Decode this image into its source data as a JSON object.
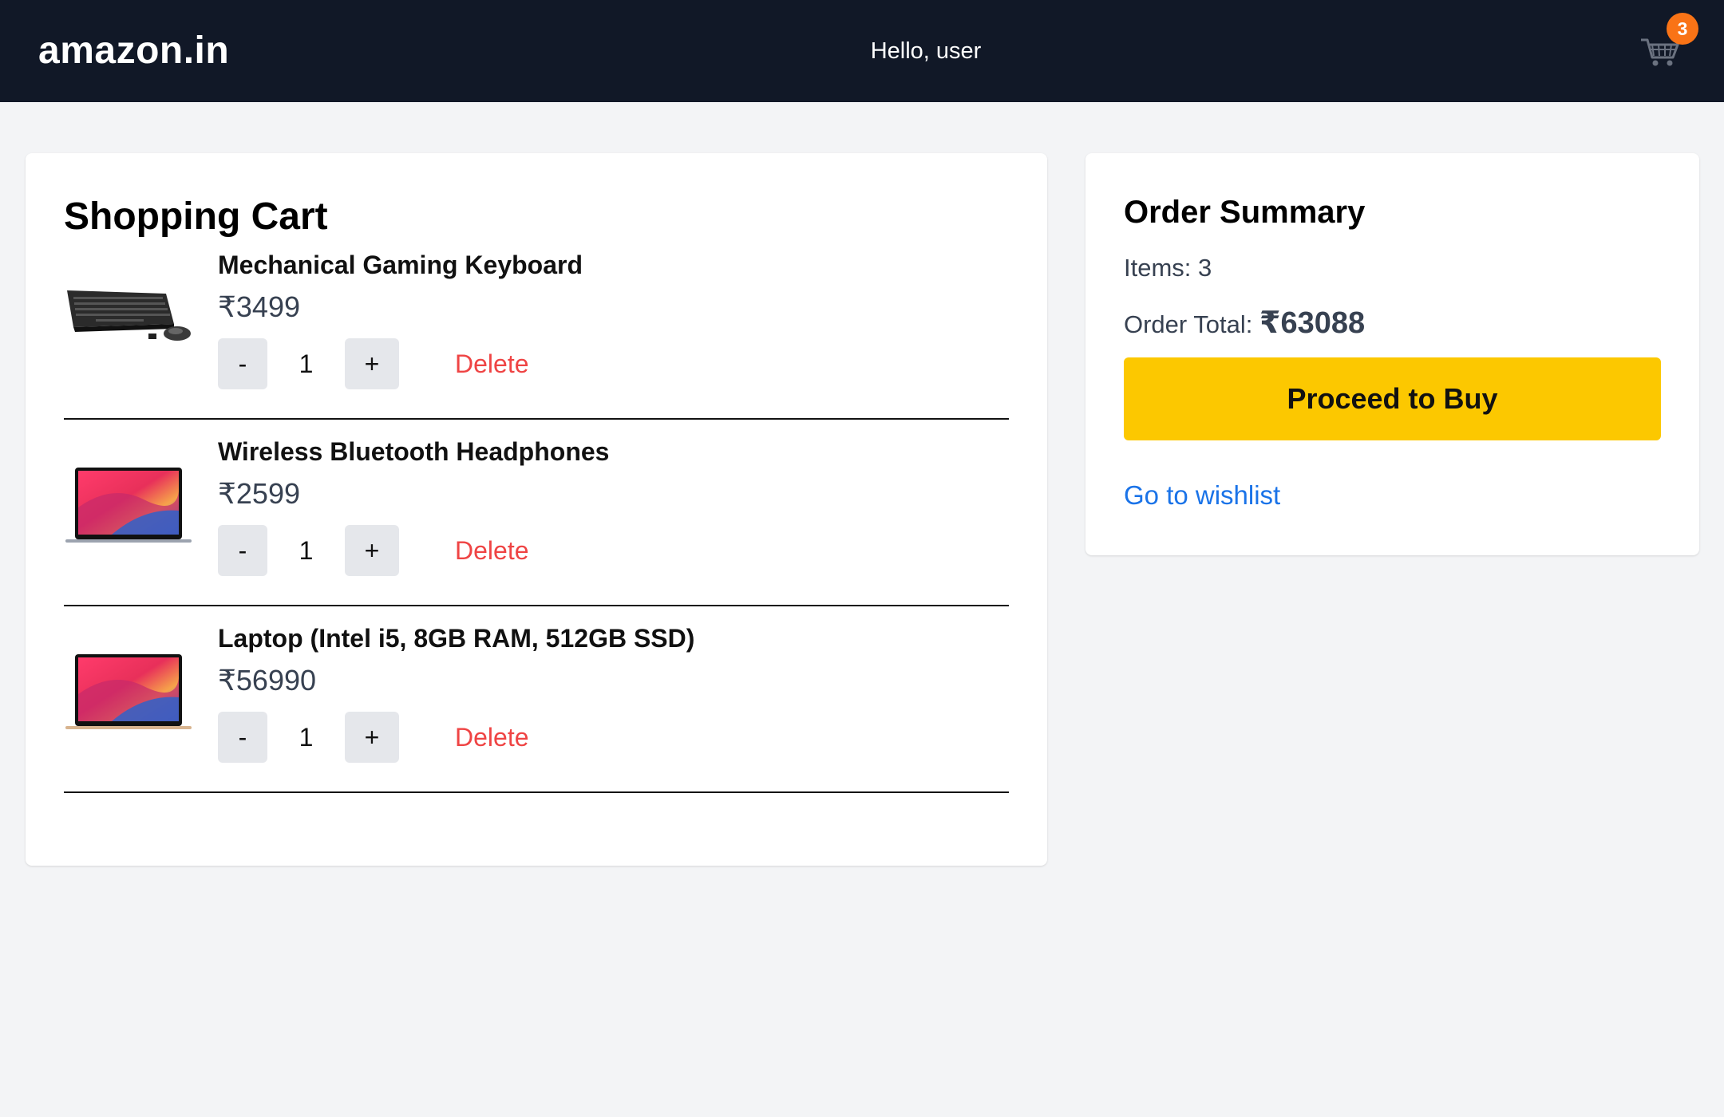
{
  "header": {
    "logo": "amazon.in",
    "greeting": "Hello, user",
    "cart_icon": "shopping-cart-icon",
    "cart_count": "3"
  },
  "cart": {
    "title": "Shopping Cart",
    "items": [
      {
        "image": "keyboard-mouse-image",
        "name": "Mechanical Gaming Keyboard",
        "price": "₹3499",
        "qty": "1",
        "minus": "-",
        "plus": "+",
        "delete": "Delete"
      },
      {
        "image": "laptop-image",
        "name": "Wireless Bluetooth Headphones",
        "price": "₹2599",
        "qty": "1",
        "minus": "-",
        "plus": "+",
        "delete": "Delete"
      },
      {
        "image": "laptop-image",
        "name": "Laptop (Intel i5, 8GB RAM, 512GB SSD)",
        "price": "₹56990",
        "qty": "1",
        "minus": "-",
        "plus": "+",
        "delete": "Delete"
      }
    ]
  },
  "summary": {
    "title": "Order Summary",
    "items_label": "Items: 3",
    "total_label": "Order Total:",
    "total_value": "₹63088",
    "buy_label": "Proceed to Buy",
    "wishlist_label": "Go to wishlist"
  },
  "colors": {
    "header_bg": "#111827",
    "page_bg": "#f3f4f6",
    "buy_button": "#fcc800",
    "delete": "#ef4444",
    "link": "#1a73e8",
    "badge": "#f97316"
  }
}
